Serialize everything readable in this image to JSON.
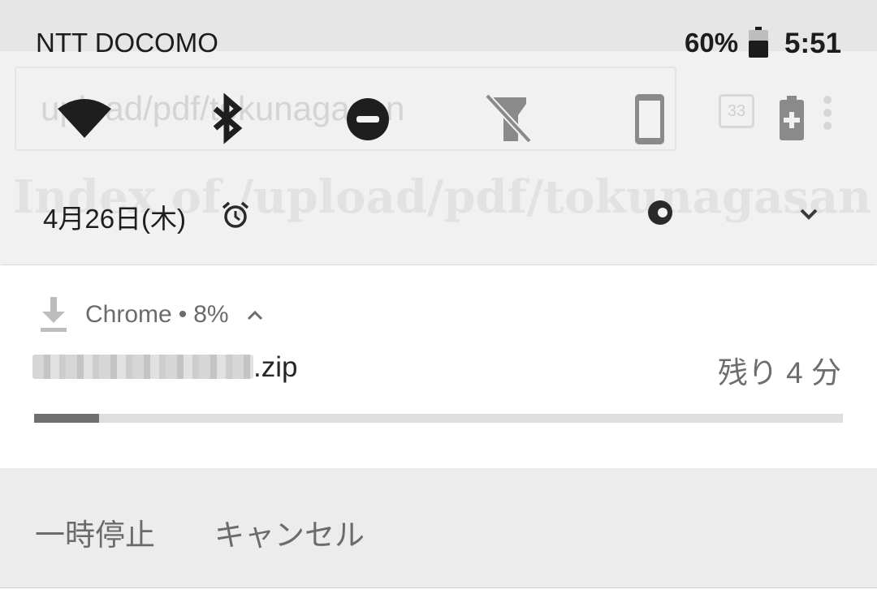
{
  "status_bar": {
    "carrier": "NTT DOCOMO",
    "battery_percent": "60%",
    "battery_level": 0.6,
    "time": "5:51"
  },
  "background_page": {
    "url_fragment": "upload/pdf/tokunagasan",
    "tab_count": "33",
    "title_fragment": "Index of /upload/pdf/tokunagasan"
  },
  "quick_settings": {
    "tiles": [
      {
        "icon": "wifi-icon"
      },
      {
        "icon": "bluetooth-icon"
      },
      {
        "icon": "do-not-disturb-icon"
      },
      {
        "icon": "flashlight-off-icon"
      },
      {
        "icon": "auto-rotate-portrait-icon"
      },
      {
        "icon": "battery-saver-icon"
      }
    ],
    "date": "4月26日(木)",
    "alarm_icon": "alarm-clock-icon",
    "user_icon": "account-icon",
    "expand_icon": "chevron-down-icon"
  },
  "notification": {
    "app_name": "Chrome",
    "separator": "•",
    "progress_text": "8%",
    "progress_fraction": 0.08,
    "filename_suffix": ".zip",
    "time_remaining": "残り 4 分",
    "icon": "download-icon",
    "collapse_icon": "chevron-up-icon"
  },
  "actions": {
    "pause_label": "一時停止",
    "cancel_label": "キャンセル"
  },
  "colors": {
    "progress_fill": "#6f6f6f",
    "progress_track": "#dedede",
    "shade_background": "#f1f1f1"
  }
}
